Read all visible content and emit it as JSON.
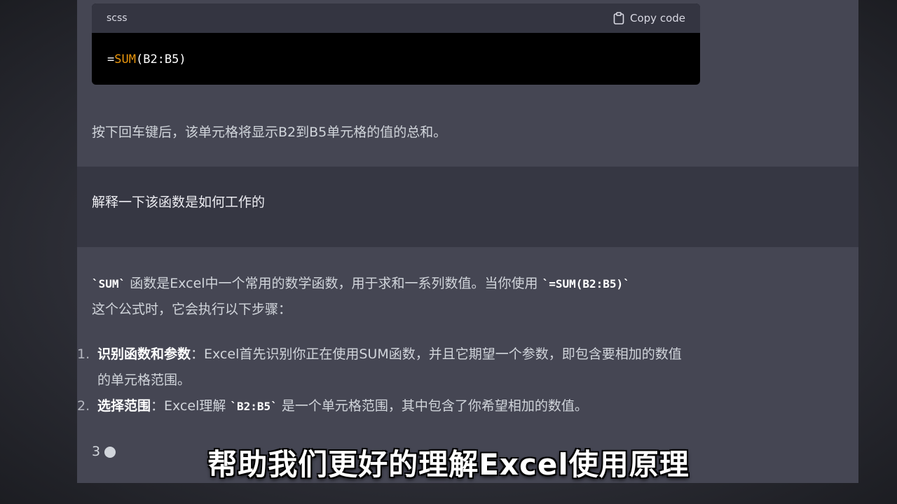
{
  "code_block": {
    "language": "scss",
    "copy_label": "Copy code",
    "code_prefix": "=",
    "code_function": "SUM",
    "code_args": "(B2:B5)"
  },
  "assistant_1": {
    "text": "按下回车键后，该单元格将显示B2到B5单元格的值的总和。"
  },
  "user_1": {
    "text": "解释一下该函数是如何工作的"
  },
  "assistant_2": {
    "intro_code_1": "`SUM`",
    "intro_text_1": " 函数是Excel中一个常用的数学函数，用于求和一系列数值。当你使用 ",
    "intro_code_2": "`=SUM(B2:B5)`",
    "intro_text_2": "这个公式时，它会执行以下步骤：",
    "list": [
      {
        "num": "1.",
        "title": "识别函数和参数",
        "text": "：Excel首先识别你正在使用SUM函数，并且它期望一个参数，即包含要相加的数值的单元格范围。"
      },
      {
        "num": "2.",
        "title": "选择范围",
        "text_before": "：Excel理解 ",
        "code": "`B2:B5`",
        "text_after": " 是一个单元格范围，其中包含了你希望相加的数值。"
      }
    ],
    "partial_num": "3"
  },
  "subtitle": "帮助我们更好的理解Excel使用原理"
}
